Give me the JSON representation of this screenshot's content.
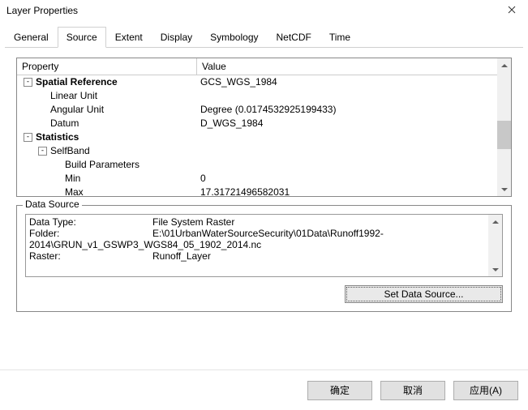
{
  "window": {
    "title": "Layer Properties"
  },
  "tabs": {
    "items": [
      {
        "label": "General"
      },
      {
        "label": "Source"
      },
      {
        "label": "Extent"
      },
      {
        "label": "Display"
      },
      {
        "label": "Symbology"
      },
      {
        "label": "NetCDF"
      },
      {
        "label": "Time"
      }
    ],
    "active_index": 1
  },
  "grid": {
    "headers": {
      "property": "Property",
      "value": "Value"
    },
    "rows": [
      {
        "level": 0,
        "expander": "-",
        "bold": true,
        "property": "Spatial Reference",
        "value": "GCS_WGS_1984"
      },
      {
        "level": 1,
        "expander": "",
        "bold": false,
        "property": "Linear Unit",
        "value": ""
      },
      {
        "level": 1,
        "expander": "",
        "bold": false,
        "property": "Angular Unit",
        "value": "Degree (0.0174532925199433)"
      },
      {
        "level": 1,
        "expander": "",
        "bold": false,
        "property": "Datum",
        "value": "D_WGS_1984"
      },
      {
        "level": 0,
        "expander": "-",
        "bold": true,
        "property": "Statistics",
        "value": ""
      },
      {
        "level": 1,
        "expander": "-",
        "bold": false,
        "property": "SelfBand",
        "value": ""
      },
      {
        "level": 2,
        "expander": "",
        "bold": false,
        "property": "Build Parameters",
        "value": ""
      },
      {
        "level": 2,
        "expander": "",
        "bold": false,
        "property": "Min",
        "value": "0"
      },
      {
        "level": 2,
        "expander": "",
        "bold": false,
        "property": "Max",
        "value": "17.31721496582031"
      }
    ]
  },
  "data_source": {
    "group_label": "Data Source",
    "lines": [
      {
        "label": "Data Type:",
        "value": "File System Raster"
      },
      {
        "label": "Folder:",
        "value": "E:\\01UrbanWaterSourceSecurity\\01Data\\Runoff1992-"
      },
      {
        "label": "",
        "value": "2014\\GRUN_v1_GSWP3_WGS84_05_1902_2014.nc"
      },
      {
        "label": "Raster:",
        "value": "Runoff_Layer"
      }
    ],
    "set_button": "Set Data Source..."
  },
  "footer": {
    "ok": "确定",
    "cancel": "取消",
    "apply": "应用(A)"
  }
}
